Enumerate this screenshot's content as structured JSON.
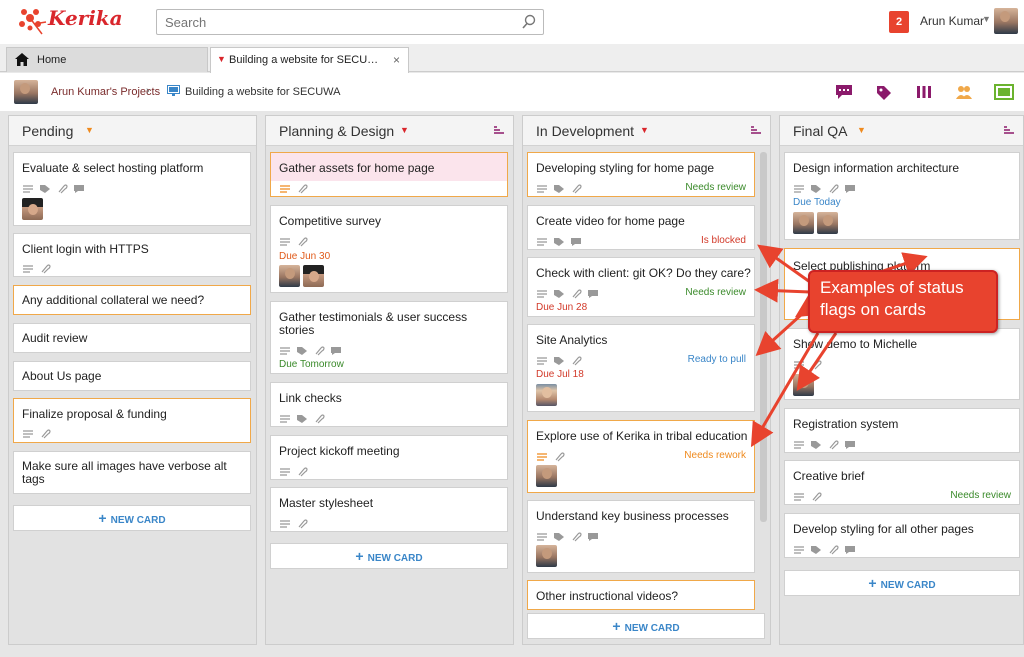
{
  "app": {
    "logo_text": "Kerika"
  },
  "search": {
    "placeholder": "Search"
  },
  "user": {
    "notifications": "2",
    "name": "Arun Kumar"
  },
  "tabs": {
    "home": "Home",
    "project": "Building a website for SECU…"
  },
  "breadcrumb": {
    "projects": "Arun Kumar's Projects",
    "separator": "›",
    "board": "Building a website for SECUWA"
  },
  "toolbar_icons": [
    "chat-icon",
    "tag-icon",
    "columns-icon",
    "team-icon",
    "fullscreen-icon"
  ],
  "columns": [
    {
      "title": "Pending",
      "cards": [
        {
          "title": "Evaluate & select hosting platform"
        },
        {
          "title": "Client login with HTTPS"
        },
        {
          "title": "Any additional collateral we need?"
        },
        {
          "title": "Audit review"
        },
        {
          "title": "About Us page"
        },
        {
          "title": "Finalize proposal & funding"
        },
        {
          "title": "Make sure all images have verbose alt tags"
        }
      ],
      "new_card": "NEW CARD"
    },
    {
      "title": "Planning & Design",
      "cards": [
        {
          "title": "Gather assets for home page"
        },
        {
          "title": "Competitive survey",
          "due": "Due Jun 30"
        },
        {
          "title": "Gather testimonials & user success stories",
          "due": "Due Tomorrow"
        },
        {
          "title": "Link checks"
        },
        {
          "title": "Project kickoff meeting"
        },
        {
          "title": "Master stylesheet"
        }
      ],
      "new_card": "NEW CARD"
    },
    {
      "title": "In Development",
      "cards": [
        {
          "title": "Developing styling for home page",
          "status": "Needs review"
        },
        {
          "title": "Create video for home page",
          "status": "Is blocked"
        },
        {
          "title": "Check with client: git OK? Do they care?",
          "status": "Needs review",
          "due": "Due Jun 28"
        },
        {
          "title": "Site Analytics",
          "status": "Ready to pull",
          "due": "Due Jul 18"
        },
        {
          "title": "Explore use of Kerika in tribal education",
          "status": "Needs rework"
        },
        {
          "title": "Understand key business processes"
        },
        {
          "title": "Other instructional videos?"
        }
      ],
      "new_card": "NEW CARD"
    },
    {
      "title": "Final QA",
      "cards": [
        {
          "title": "Design information architecture",
          "due": "Due Today"
        },
        {
          "title": "Select publishing platform"
        },
        {
          "title": "Show demo to Michelle"
        },
        {
          "title": "Registration system"
        },
        {
          "title": "Creative brief",
          "status": "Needs review"
        },
        {
          "title": "Develop styling for all other pages"
        }
      ],
      "new_card": "NEW CARD"
    }
  ],
  "annotation": {
    "line1": "Examples of status",
    "line2": "flags on cards"
  },
  "colors": {
    "brand_red": "#d9262c",
    "accent_purple": "#8b1a6b",
    "highlight_orange": "#f0a849",
    "due_orange": "#e05a1a",
    "due_red": "#d23a2a",
    "due_green": "#3a8a2a",
    "due_blue": "#3a86c8",
    "status_green": "#3a8a2a",
    "status_red": "#d23a2a",
    "status_blue": "#3a86c8",
    "status_orange": "#ef8a1e",
    "callout_red": "#e8432e"
  }
}
